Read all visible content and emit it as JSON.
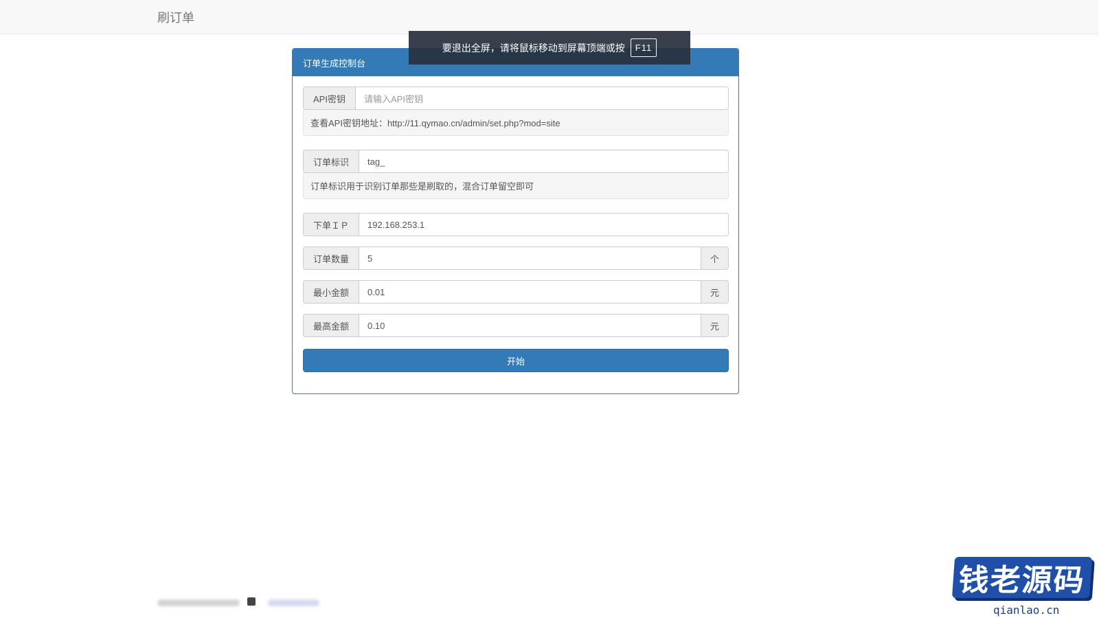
{
  "navbar": {
    "brand": "刷订单"
  },
  "fullscreen_notice": {
    "text": "要退出全屏，请将鼠标移动到屏幕顶端或按",
    "key": "F11"
  },
  "panel": {
    "title": "订单生成控制台",
    "api_key": {
      "label": "API密钥",
      "placeholder": "请输入API密钥",
      "help": "查看API密钥地址：http://11.qymao.cn/admin/set.php?mod=site"
    },
    "order_tag": {
      "label": "订单标识",
      "value": "tag_",
      "help": "订单标识用于识别订单那些是刷取的，混合订单留空即可"
    },
    "order_ip": {
      "label": "下单ＩＰ",
      "value": "192.168.253.1"
    },
    "order_count": {
      "label": "订单数量",
      "value": "5",
      "unit": "个"
    },
    "min_amount": {
      "label": "最小金额",
      "value": "0.01",
      "unit": "元"
    },
    "max_amount": {
      "label": "最高金额",
      "value": "0.10",
      "unit": "元"
    },
    "start_button": "开始"
  },
  "watermark": {
    "text": "钱老源码",
    "sub": "qianlao.cn"
  }
}
